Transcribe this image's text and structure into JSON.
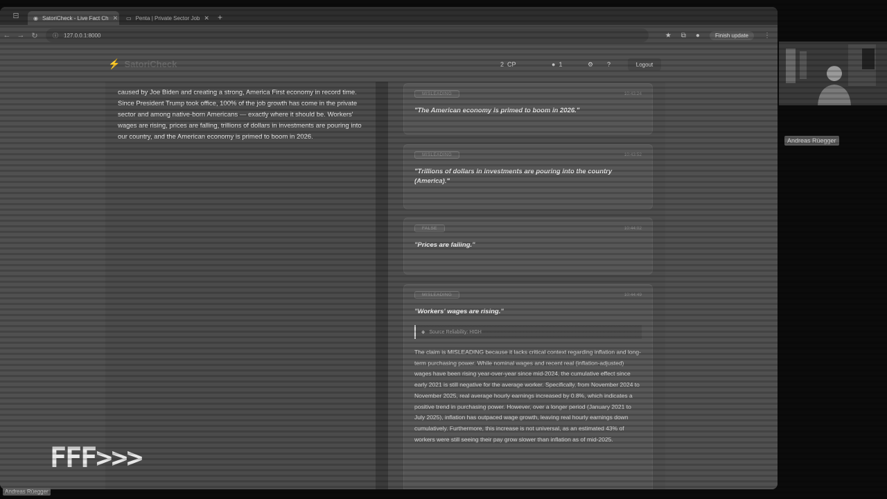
{
  "browser": {
    "tabs": [
      {
        "label": "SatoriCheck - Live Fact Ch",
        "active": true
      },
      {
        "label": "Penta | Private Sector Job",
        "active": false
      }
    ],
    "url": "127.0.0.1:8000",
    "finish_update": "Finish update"
  },
  "app": {
    "name": "SatoriCheck",
    "header_count_a": "2",
    "header_count_a_suffix": "CP",
    "header_count_b": "1",
    "logout_label": "Logout"
  },
  "transcript": {
    "text": "caused by Joe Biden and creating a strong, America First economy in record time. Since President Trump took office, 100% of the job growth has come in the private sector and among native-born Americans — exactly where it should be. Workers' wages are rising, prices are falling, trillions of dollars in investments are pouring into our country, and the American economy is primed to boom in 2026."
  },
  "claims": [
    {
      "verdict": "MISLEADING",
      "time": "10:43:24",
      "quote": "\"The American economy is primed to boom in 2026.\""
    },
    {
      "verdict": "MISLEADING",
      "time": "10:43:52",
      "quote": "\"Trillions of dollars in investments are pouring into the country (America).\""
    },
    {
      "verdict": "FALSE",
      "time": "10:44:02",
      "quote": "\"Prices are falling.\""
    },
    {
      "verdict": "MISLEADING",
      "time": "10:44:49",
      "quote": "\"Workers' wages are rising.\"",
      "source_reliability": "Source Reliability: HIGH",
      "explanation": "The claim is MISLEADING because it lacks critical context regarding inflation and long-term purchasing power. While nominal wages and recent real (inflation-adjusted) wages have been rising year-over-year since mid-2024, the cumulative effect since early 2021 is still negative for the average worker. Specifically, from November 2024 to November 2025, real average hourly earnings increased by 0.8%, which indicates a positive trend in purchasing power. However, over a longer period (January 2021 to July 2025), inflation has outpaced wage growth, leaving real hourly earnings down cumulatively. Furthermore, this increase is not universal, as an estimated 43% of workers were still seeing their pay grow slower than inflation as of mid-2025."
    }
  ],
  "overlay": {
    "webcam_name": "Andreas Rüegger",
    "bottom_name": "Andreas Rüegger",
    "logo_text": "FFF>>>"
  }
}
